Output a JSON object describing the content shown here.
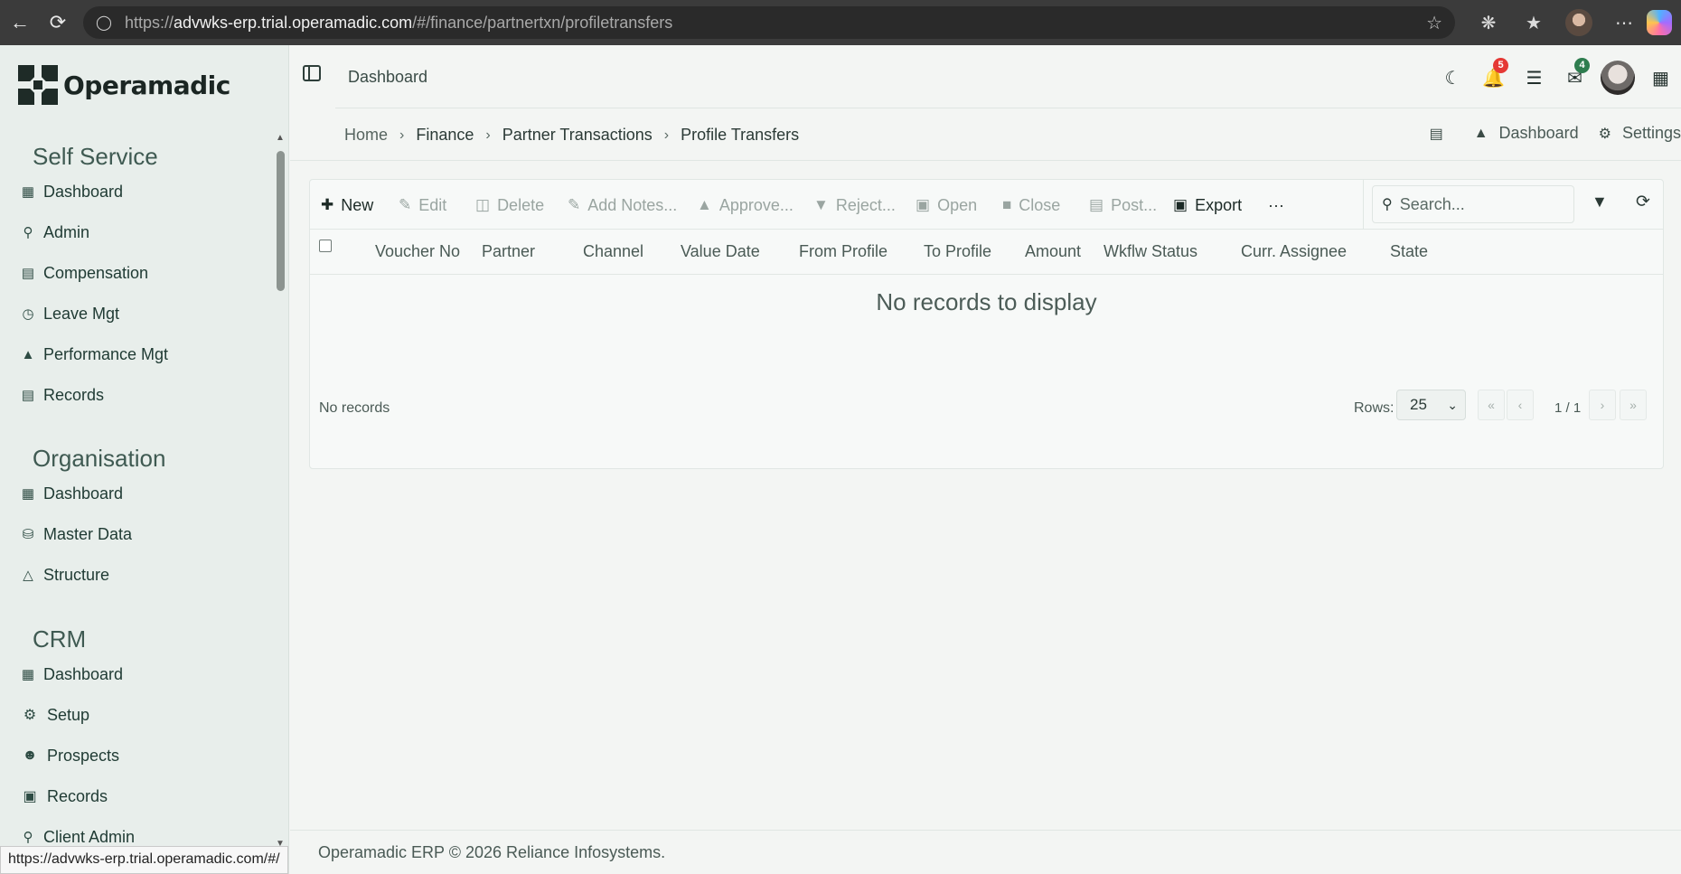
{
  "browser": {
    "url_prefix": "https://",
    "url_host": "advwks-erp.trial.operamadic.com",
    "url_path": "/#/finance/partnertxn/profiletransfers",
    "status_url": "https://advwks-erp.trial.operamadic.com/#/"
  },
  "brand": {
    "name": "Operamadic"
  },
  "sidebar": {
    "sections": [
      {
        "title": "Self Service",
        "items": [
          "Dashboard",
          "Admin",
          "Compensation",
          "Leave Mgt",
          "Performance Mgt",
          "Records"
        ]
      },
      {
        "title": "Organisation",
        "items": [
          "Dashboard",
          "Master Data",
          "Structure"
        ]
      },
      {
        "title": "CRM",
        "items": [
          "Dashboard",
          "Setup",
          "Prospects",
          "Records",
          "Client Admin"
        ]
      }
    ]
  },
  "header": {
    "title": "Dashboard",
    "notifications_count": "5",
    "messages_count": "4"
  },
  "breadcrumb": {
    "items": [
      "Home",
      "Finance",
      "Partner Transactions",
      "Profile Transfers"
    ],
    "right_links": [
      "Dashboard",
      "Settings"
    ]
  },
  "toolbar": {
    "new": "New",
    "edit": "Edit",
    "delete": "Delete",
    "add_notes": "Add Notes...",
    "approve": "Approve...",
    "reject": "Reject...",
    "open": "Open",
    "close": "Close",
    "post": "Post...",
    "export": "Export",
    "more": "···",
    "search_placeholder": "Search..."
  },
  "table": {
    "columns": [
      "Voucher No",
      "Partner",
      "Channel",
      "Value Date",
      "From Profile",
      "To Profile",
      "Amount",
      "Wkflw Status",
      "Curr. Assignee",
      "State"
    ],
    "empty_message": "No records to display",
    "footer_status": "No records",
    "rows_label": "Rows:",
    "rows_per_page": "25",
    "page_info": "1 / 1",
    "pager": {
      "first": "«",
      "prev": "‹",
      "next": "›",
      "last": "»"
    }
  },
  "footer": {
    "text": "Operamadic ERP © 2026 Reliance Infosystems."
  }
}
